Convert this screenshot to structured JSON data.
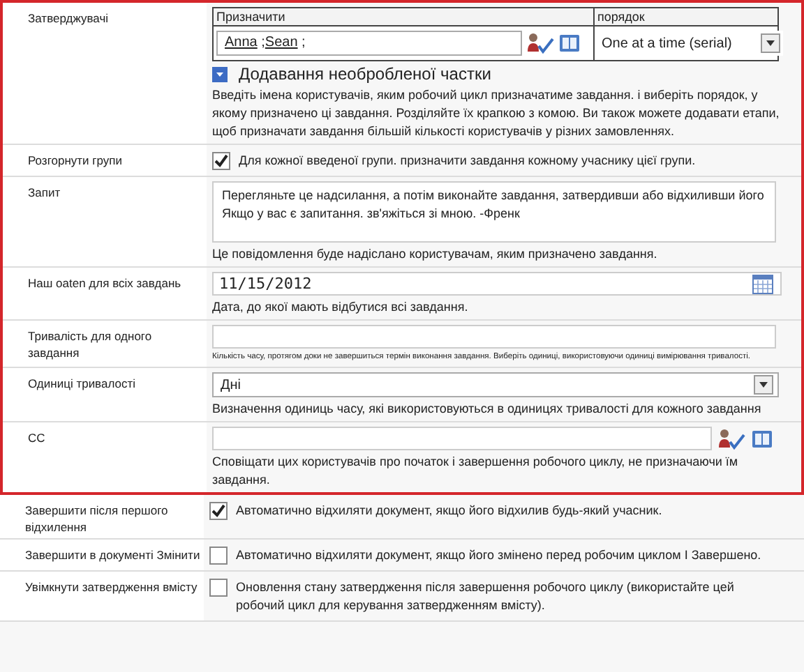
{
  "highlighted_sections": [
    {
      "kind": "approvers",
      "label": "Затверджувачі",
      "columns": [
        "Призначити",
        "порядок"
      ],
      "assignees": [
        "Anna",
        "Sean"
      ],
      "separator": ";",
      "order": "One at a time (serial)",
      "expander": "Додавання необробленої частки",
      "description": "Введіть імена користувачів, яким робочий цикл призначатиме завдання. і виберіть порядок, у якому призначено ці завдання. Розділяйте їх крапкою з комою. Ви також можете додавати етапи, щоб призначати завдання більшій кількості користувачів у різних замовленнях."
    },
    {
      "kind": "checkbox",
      "label": "Розгорнути групи",
      "checked": true,
      "text": "Для кожної введеної групи. призначити завдання кожному учаснику цієї групи."
    },
    {
      "kind": "textarea",
      "label": "Запит",
      "value": "Перегляньте це надсилання, а потім виконайте завдання, затвердивши або відхиливши його Якщо у вас є запитання. зв'яжіться зі мною. -Френк",
      "hint": "Це повідомлення буде надіслано користувачам, яким призначено завдання."
    },
    {
      "kind": "date",
      "label": "Наш oaten для всіх завдань",
      "value": "11/15/2012",
      "hint": "Дата, до якої мають відбутися всі завдання."
    },
    {
      "kind": "text",
      "label": "Тривалість для одного завдання",
      "hint": "Кількість часу, протягом доки не завершиться термін виконання завдання. Виберіть одиниці, використовуючи одиниці вимірювання тривалості."
    },
    {
      "kind": "select",
      "label": "Одиниці тривалості",
      "value": "Дні",
      "hint": "Визначення одиниць часу, які використовуються в одиницях тривалості для кожного завдання"
    },
    {
      "kind": "people",
      "label": "CC",
      "hint": "Сповіщати цих користувачів про початок і завершення робочого циклу, не призначаючи їм завдання."
    }
  ],
  "sections": [
    {
      "kind": "checkbox",
      "label": "Завершити після першого відхилення",
      "checked": true,
      "text": "Автоматично відхиляти документ, якщо його відхилив будь-який учасник."
    },
    {
      "kind": "checkbox",
      "label": "Завершити в документі Змінити",
      "checked": false,
      "text": "Автоматично відхиляти документ, якщо його змінено перед робочим циклом І Завершено."
    },
    {
      "kind": "checkbox",
      "label": "Увімкнути затвердження вмісту",
      "checked": false,
      "text": "Оновлення стану затвердження після завершення робочого циклу (використайте цей робочий цикл для керування затвердженням вмісту)."
    }
  ]
}
